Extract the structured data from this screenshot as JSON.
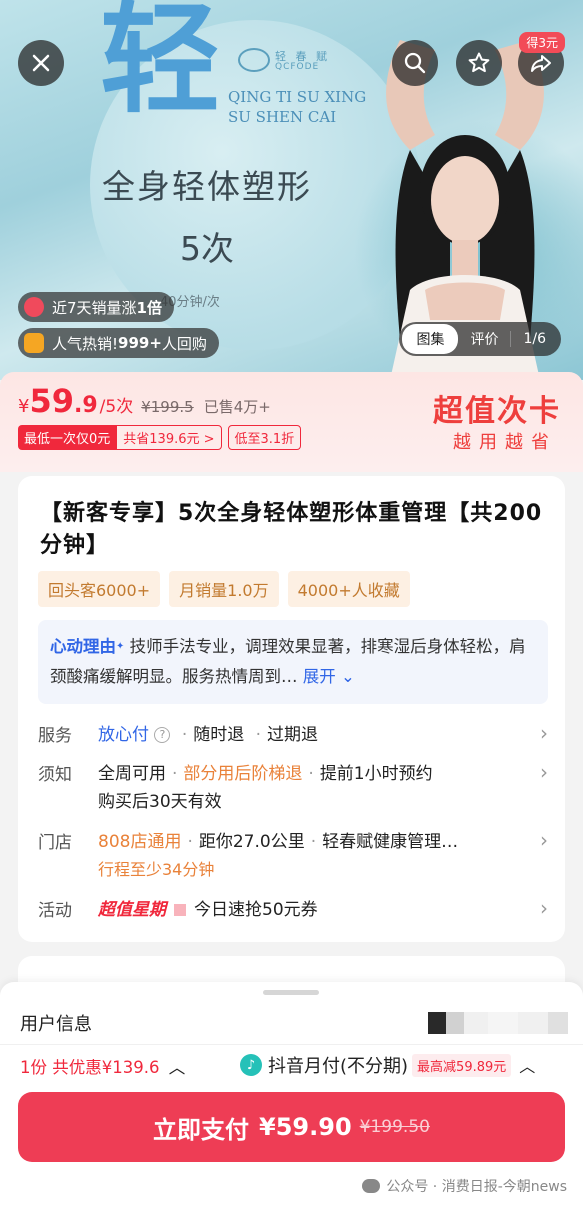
{
  "hero": {
    "big_char": "轻",
    "brand_cn": "轻 春 赋",
    "brand_en": "QCFODE",
    "slogan_line1": "QING TI SU XING",
    "slogan_line2": "SU SHEN CAI",
    "title_line1": "全身轻体塑形",
    "title_line2": "5次",
    "duration": "40分钟/次",
    "coupon_tag": "得3元",
    "badge_sales_pre": "近7天销量涨",
    "badge_sales_bold": "1倍",
    "badge_hot_pre": "人气热销! ",
    "badge_hot_bold": "999+",
    "badge_hot_post": "人回购",
    "gallery_active": "图集",
    "gallery_review": "评价",
    "gallery_count": "1/6"
  },
  "price": {
    "symbol": "¥",
    "integer": "59",
    "decimal": ".9",
    "unit": "/5次",
    "original": "¥199.5",
    "sold": "已售4万+",
    "tag_lowest": "最低一次仅0元",
    "tag_save": "共省139.6元 >",
    "tag_discount": "低至3.1折",
    "promo_big": "超值次卡",
    "promo_small": "越用越省"
  },
  "product": {
    "title": "【新客专享】5次全身轻体塑形体重管理【共200分钟】",
    "chips": [
      "回头客6000+",
      "月销量1.0万",
      "4000+人收藏"
    ],
    "reason_label": "心动理由",
    "reason_text": " 技师手法专业，调理效果显著，排寒湿后身体轻松，肩颈酸痛缓解明显。服务热情周到…",
    "reason_expand": "展开"
  },
  "info": {
    "service_label": "服务",
    "service_main": "放心付",
    "service_items": [
      "随时退",
      "过期退"
    ],
    "notice_label": "须知",
    "notice_a": "全周可用",
    "notice_b": "部分用后阶梯退",
    "notice_c": "提前1小时预约",
    "notice_d": "购买后30天有效",
    "store_label": "门店",
    "store_a": "808店通用",
    "store_b": "距你27.0公里",
    "store_c": "轻春赋健康管理…",
    "store_d": "行程至少34分钟",
    "activity_label": "活动",
    "activity_tag": "超值星期",
    "activity_text": "今日速抢50元券"
  },
  "sheet": {
    "user_info": "用户信息",
    "qty_text": "1份 共优惠¥139.6",
    "pay_method": "抖音月付(不分期)",
    "max_off": "最高减59.89元",
    "pay_label": "立即支付",
    "pay_price": "¥59.90",
    "pay_orig": "¥199.50",
    "watermark": "公众号 · 消费日报-今朝news"
  },
  "colors": {
    "accent_red": "#f0283c",
    "pay_button": "#ee3d55",
    "link_blue": "#3166e6",
    "orange": "#e9823a"
  }
}
